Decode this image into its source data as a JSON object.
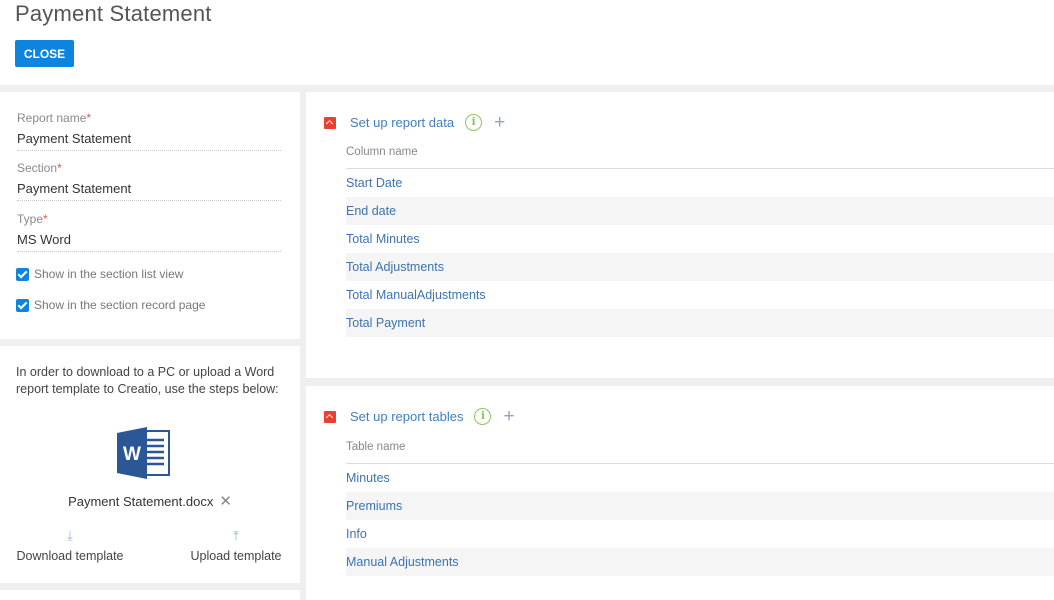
{
  "page": {
    "title": "Payment Statement",
    "close_label": "CLOSE"
  },
  "properties": {
    "report_name": {
      "label": "Report name",
      "required_mark": "*",
      "value": "Payment Statement"
    },
    "section": {
      "label": "Section",
      "required_mark": "*",
      "value": "Payment Statement"
    },
    "type": {
      "label": "Type",
      "required_mark": "*",
      "value": "MS Word"
    },
    "show_in_list": {
      "label": "Show in the section list view",
      "checked": true
    },
    "show_in_record": {
      "label": "Show in the section record page",
      "checked": true
    }
  },
  "template": {
    "instruction": "In order to download to a PC or upload a Word report template to Creatio, use the steps below:",
    "icon": "word-document-icon",
    "file_name": "Payment Statement.docx",
    "remove_glyph": "✕",
    "download_label": "Download template",
    "upload_label": "Upload template"
  },
  "report_data": {
    "title": "Set up report data",
    "column_header": "Column name",
    "rows": [
      "Start Date",
      "End date",
      "Total Minutes",
      "Total Adjustments",
      "Total ManualAdjustments",
      "Total Payment"
    ]
  },
  "report_tables": {
    "title": "Set up report tables",
    "column_header": "Table name",
    "rows": [
      "Minutes",
      "Premiums",
      "Info",
      "Manual Adjustments"
    ]
  },
  "colors": {
    "accent": "#0d84e0",
    "collapse": "#e5432f",
    "info": "#8cc85a",
    "link": "#3d73b0"
  }
}
